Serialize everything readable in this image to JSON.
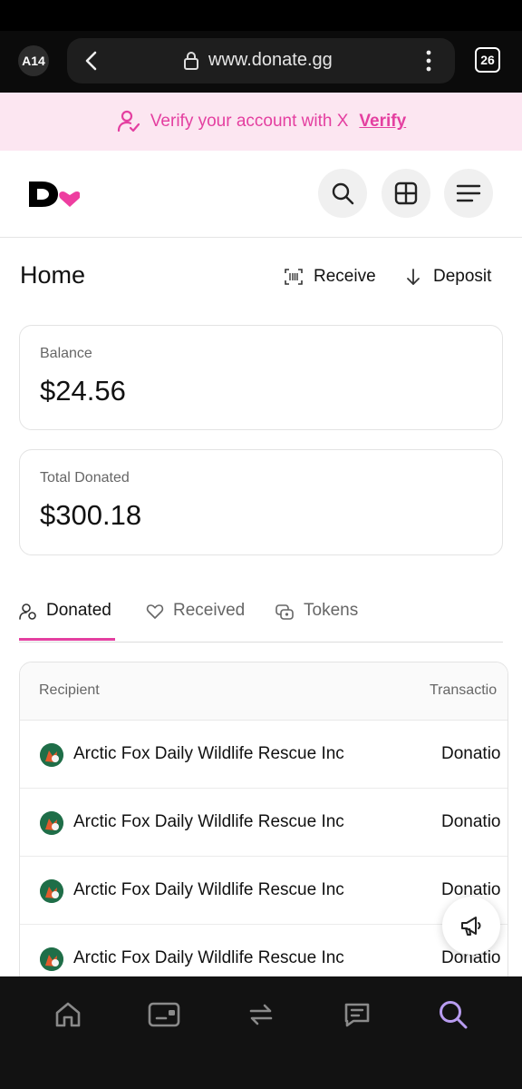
{
  "browser": {
    "tab_label": "A14",
    "url": "www.donate.gg",
    "tab_count": "26"
  },
  "banner": {
    "text": "Verify your account with X",
    "link": "Verify",
    "accent": "#e43fa0"
  },
  "header": {
    "logo": "D",
    "buttons": [
      "search-icon",
      "grid-icon",
      "menu-icon"
    ]
  },
  "page": {
    "title": "Home",
    "receive_label": "Receive",
    "deposit_label": "Deposit"
  },
  "cards": {
    "balance_label": "Balance",
    "balance_value": "$24.56",
    "donated_label": "Total Donated",
    "donated_value": "$300.18"
  },
  "tabs": [
    {
      "label": "Donated",
      "icon": "users-icon",
      "active": true
    },
    {
      "label": "Received",
      "icon": "heart-icon",
      "active": false
    },
    {
      "label": "Tokens",
      "icon": "tokens-icon",
      "active": false
    }
  ],
  "table": {
    "columns": [
      "Recipient",
      "Transactio"
    ],
    "rows": [
      {
        "recipient": "Arctic Fox Daily Wildlife Rescue Inc",
        "type": "Donatio"
      },
      {
        "recipient": "Arctic Fox Daily Wildlife Rescue Inc",
        "type": "Donatio"
      },
      {
        "recipient": "Arctic Fox Daily Wildlife Rescue Inc",
        "type": "Donatio"
      },
      {
        "recipient": "Arctic Fox Daily Wildlife Rescue Inc",
        "type": "Donatio"
      }
    ]
  },
  "bottom_nav": [
    "home-icon",
    "wallet-icon",
    "swap-icon",
    "messages-icon",
    "search-icon"
  ],
  "colors": {
    "active_nav": "#b89cf0",
    "inactive_nav": "#8a8a8a"
  }
}
